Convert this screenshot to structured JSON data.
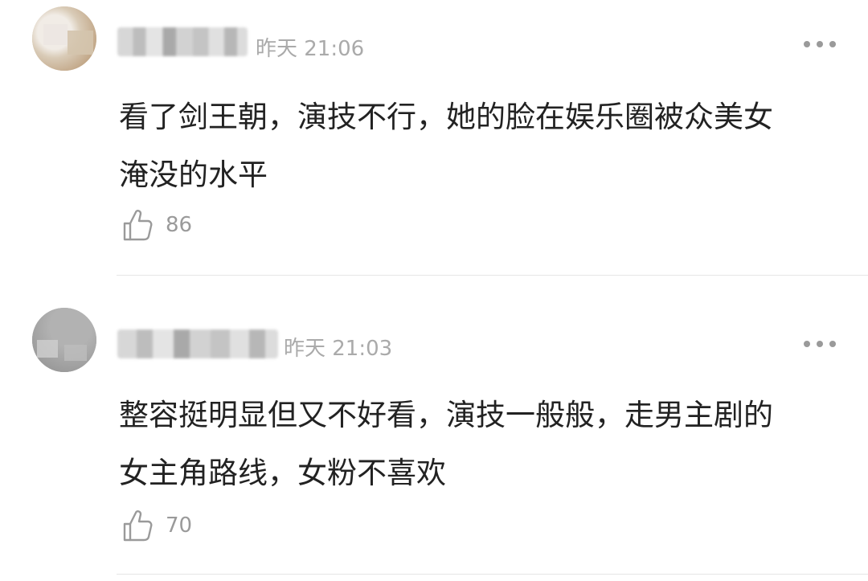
{
  "comments": [
    {
      "time": "昨天 21:06",
      "text_lines": [
        "看了剑王朝，演技不行，她的脸在娱乐圈被众美女",
        "淹没的水平"
      ],
      "likes": "86"
    },
    {
      "time": "昨天 21:03",
      "text_lines": [
        "整容挺明显但又不好看，演技一般般，走男主剧的",
        "女主角路线，女粉不喜欢"
      ],
      "likes": "70"
    }
  ],
  "icons": {
    "more": "more-dots-icon",
    "like": "thumbs-up-icon"
  },
  "colors": {
    "text": "#222222",
    "meta": "#aaaaaa",
    "divider": "#e6e6e6"
  }
}
